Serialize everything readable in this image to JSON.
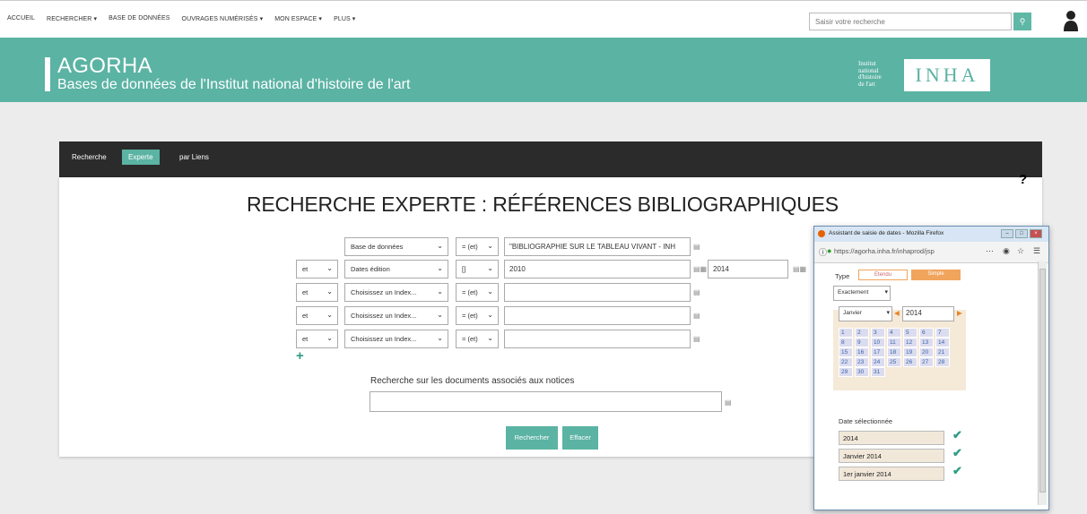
{
  "nav": {
    "items": [
      "ACCUEIL",
      "RECHERCHER ▾",
      "BASE DE DONNÉES",
      "OUVRAGES NUMÉRISÉS ▾",
      "MON ESPACE ▾",
      "PLUS ▾"
    ],
    "search_placeholder": "Saisir votre recherche"
  },
  "banner": {
    "title": "AGORHA",
    "subtitle": "Bases de données de l'Institut national d'histoire de l'art",
    "inst": [
      "Institut",
      "national",
      "d'histoire",
      "de l'art"
    ],
    "logo": "INHA"
  },
  "tabs": [
    "Recherche",
    "Experte",
    "par Liens"
  ],
  "page": {
    "help": "?",
    "title": "RECHERCHE EXPERTE : RÉFÉRENCES BIBLIOGRAPHIQUES"
  },
  "rows": [
    {
      "op": "",
      "field": "Base de données",
      "cond": "= (et)",
      "value": "\"BIBLIOGRAPHIE SUR LE TABLEAU VIVANT - INH"
    },
    {
      "op": "et",
      "field": "Dates édition",
      "cond": "[]",
      "value": "2010",
      "value2": "2014"
    },
    {
      "op": "et",
      "field": "Choisissez un Index...",
      "cond": "= (et)",
      "value": ""
    },
    {
      "op": "et",
      "field": "Choisissez un Index...",
      "cond": "= (et)",
      "value": ""
    },
    {
      "op": "et",
      "field": "Choisissez un Index...",
      "cond": "= (et)",
      "value": ""
    }
  ],
  "docsearch": {
    "label": "Recherche sur les documents associés aux notices",
    "value": ""
  },
  "buttons": {
    "search": "Rechercher",
    "clear": "Effacer"
  },
  "popup": {
    "title": "Assistant de saisie de dates - Mozilla Firefox",
    "url": "https://agorha.inha.fr/inhaprod/jsp",
    "type_label": "Type",
    "type_options": [
      "Etendu",
      "Simple"
    ],
    "precision": "Exactement",
    "month": "Janvier",
    "year": "2014",
    "days": [
      "1",
      "2",
      "3",
      "4",
      "5",
      "6",
      "7",
      "8",
      "9",
      "10",
      "11",
      "12",
      "13",
      "14",
      "15",
      "16",
      "17",
      "18",
      "19",
      "20",
      "21",
      "22",
      "23",
      "24",
      "25",
      "26",
      "27",
      "28",
      "29",
      "30",
      "31"
    ],
    "selected_label": "Date sélectionnée",
    "dates": [
      "2014",
      "Janvier 2014",
      "1er janvier 2014"
    ]
  },
  "colors": {
    "accent": "#5bb3a3",
    "dark_bar": "#2b2b2b"
  }
}
